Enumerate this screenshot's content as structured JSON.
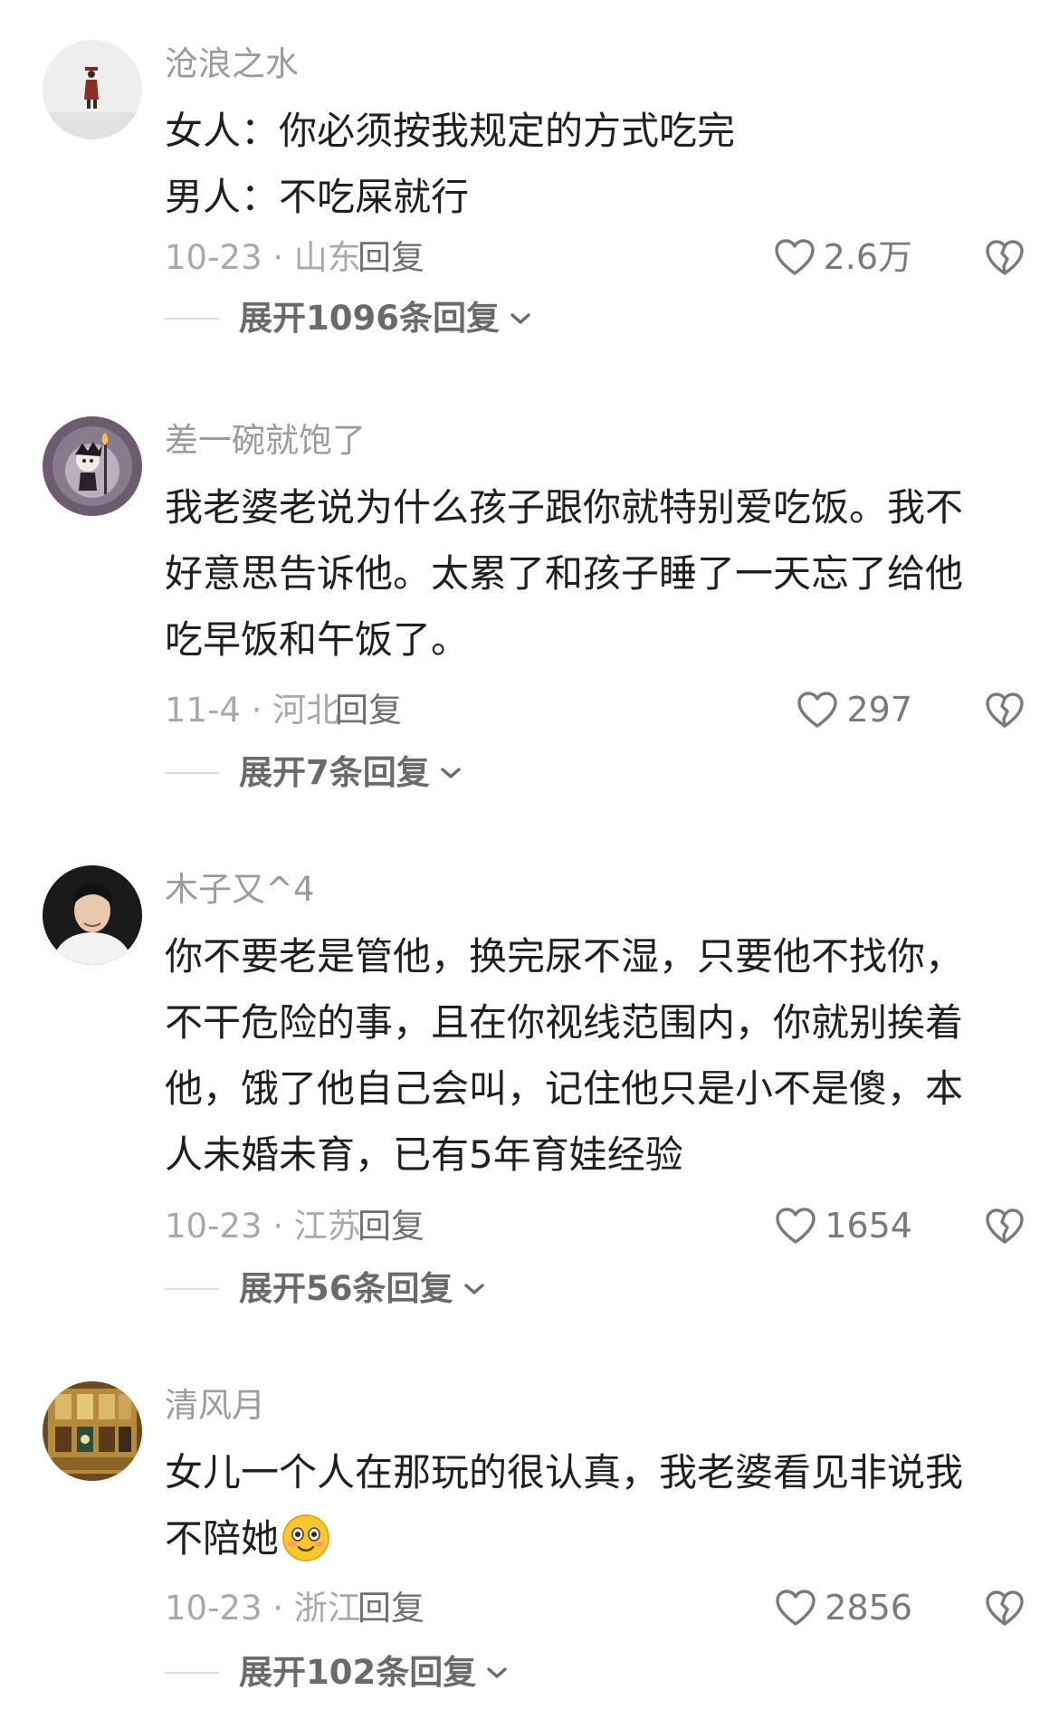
{
  "comments": [
    {
      "username": "沧浪之水",
      "lines": [
        "女人：你必须按我规定的方式吃完",
        "男人：不吃屎就行"
      ],
      "date_loc": "10-23 · 山东",
      "reply_label": "回复",
      "likes": "2.6万",
      "expand_label": "展开1096条回复"
    },
    {
      "username": "差一碗就饱了",
      "lines": [
        "我老婆老说为什么孩子跟你就特别爱吃饭。我不",
        "好意思告诉他。太累了和孩子睡了一天忘了给他",
        "吃早饭和午饭了。"
      ],
      "date_loc": "11-4 · 河北",
      "reply_label": "回复",
      "likes": "297",
      "expand_label": "展开7条回复"
    },
    {
      "username": "木子又^4",
      "lines": [
        "你不要老是管他，换完尿不湿，只要他不找你，",
        "不干危险的事，且在你视线范围内，你就别挨着",
        "他，饿了他自己会叫，记住他只是小不是傻，本",
        "人未婚未育，已有5年育娃经验"
      ],
      "date_loc": "10-23 · 江苏",
      "reply_label": "回复",
      "likes": "1654",
      "expand_label": "展开56条回复"
    },
    {
      "username": "清风月",
      "lines": [
        "女儿一个人在那玩的很认真，我老婆看见非说我",
        "不陪她"
      ],
      "date_loc": "10-23 · 浙江",
      "reply_label": "回复",
      "likes": "2856",
      "expand_label": "展开102条回复"
    }
  ],
  "icons": {
    "like": "heart-outline-icon",
    "dislike": "broken-heart-icon",
    "expand": "chevron-down-icon",
    "emoji": "blushing-smile-emoji"
  },
  "colors": {
    "username": "#9b9b9b",
    "content": "#1f1f1f",
    "meta": "#a9a9a9",
    "reply": "#6f6f6f",
    "expand": "#6a6a6a",
    "emoji": "#f7c82e"
  }
}
